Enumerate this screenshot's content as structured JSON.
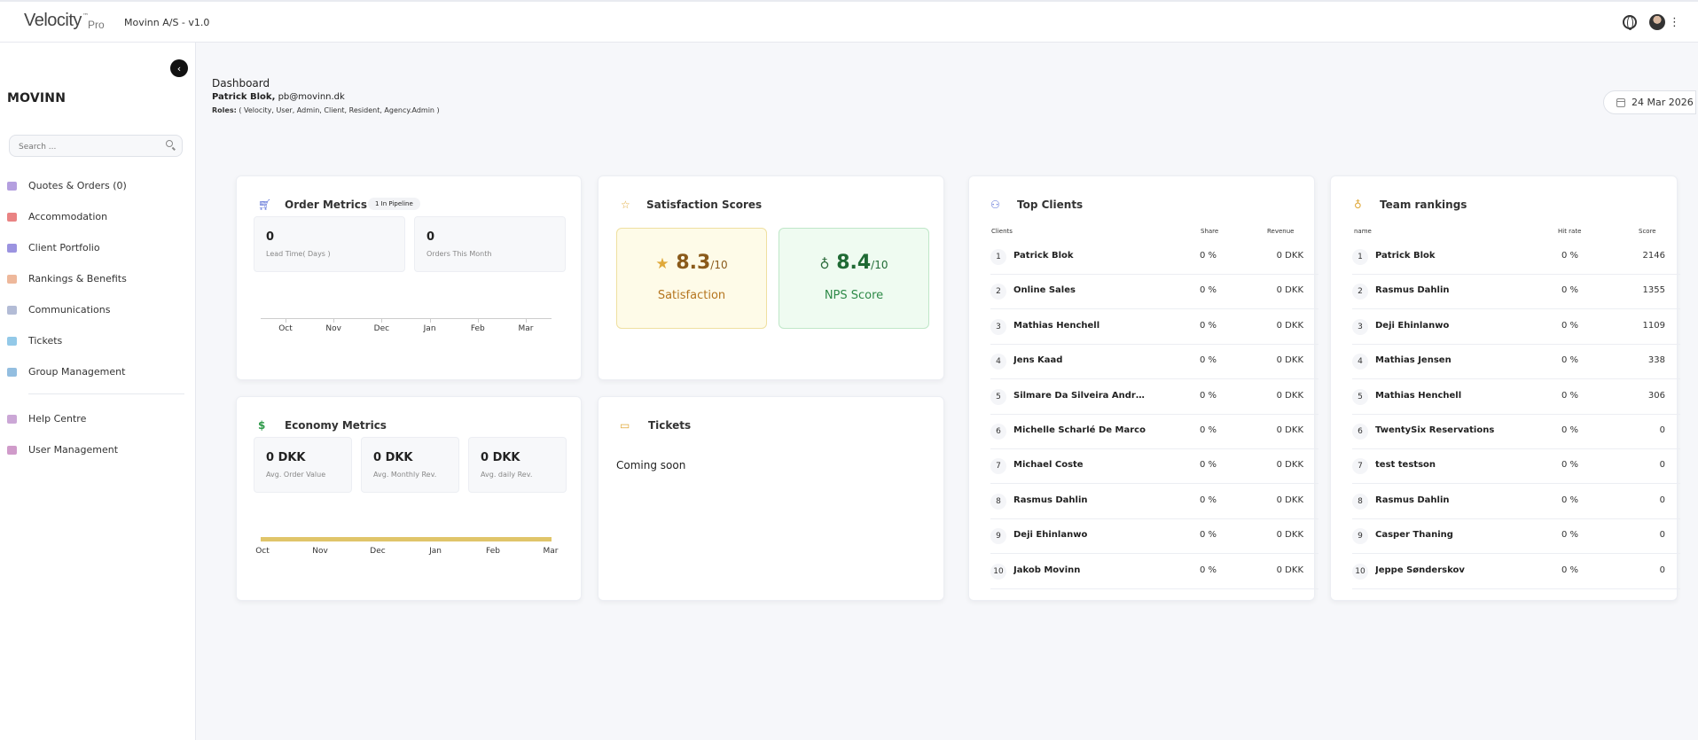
{
  "header": {
    "brand": "Velocity",
    "brand_tm": "™",
    "brand_sub": "Pro",
    "company": "Movinn A/S - v1.0"
  },
  "sidebar": {
    "org": "MOVINN",
    "search_placeholder": "Search ...",
    "items": [
      {
        "label": "Quotes & Orders (0)",
        "icon": "quotes-icon",
        "color": "#9b7fd4"
      },
      {
        "label": "Accommodation",
        "icon": "accommodation-icon",
        "color": "#e25a5a"
      },
      {
        "label": "Client Portfolio",
        "icon": "portfolio-icon",
        "color": "#7a6fd6"
      },
      {
        "label": "Rankings & Benefits",
        "icon": "rankings-icon",
        "color": "#e8a07a"
      },
      {
        "label": "Communications",
        "icon": "communications-icon",
        "color": "#9aa6c8"
      },
      {
        "label": "Tickets",
        "icon": "tickets-icon",
        "color": "#6fb7e0"
      },
      {
        "label": "Group Management",
        "icon": "group-icon",
        "color": "#6fa8d6"
      }
    ],
    "footer_items": [
      {
        "label": "Help Centre",
        "icon": "help-icon",
        "color": "#b98ac8"
      },
      {
        "label": "User Management",
        "icon": "user-management-icon",
        "color": "#c07ab8"
      }
    ]
  },
  "page": {
    "title": "Dashboard",
    "user_name": "Patrick Blok,",
    "user_email": "pb@movinn.dk",
    "roles_label": "Roles:",
    "roles": "( Velocity, User, Admin, Client, Resident, Agency.Admin )",
    "date": "24 Mar 2026"
  },
  "order_metrics": {
    "title": "Order Metrics",
    "pill": "1 In Pipeline",
    "lead_value": "0",
    "lead_label": "Lead Time( Days )",
    "orders_value": "0",
    "orders_label": "Orders This Month",
    "months": [
      "Oct",
      "Nov",
      "Dec",
      "Jan",
      "Feb",
      "Mar"
    ]
  },
  "economy_metrics": {
    "title": "Economy Metrics",
    "boxes": [
      {
        "value": "0 DKK",
        "label": "Avg. Order Value"
      },
      {
        "value": "0 DKK",
        "label": "Avg. Monthly Rev."
      },
      {
        "value": "0 DKK",
        "label": "Avg. daily Rev."
      }
    ],
    "months": [
      "Oct",
      "Nov",
      "Dec",
      "Jan",
      "Feb",
      "Mar"
    ],
    "line_color": "#e0c56a"
  },
  "satisfaction": {
    "title": "Satisfaction Scores",
    "satisfaction_value": "8.3",
    "satisfaction_max": "/10",
    "satisfaction_label": "Satisfaction",
    "nps_value": "8.4",
    "nps_max": "/10",
    "nps_label": "NPS Score"
  },
  "tickets": {
    "title": "Tickets",
    "body": "Coming soon"
  },
  "top_clients": {
    "title": "Top Clients",
    "headers": {
      "name": "Clients",
      "share": "Share",
      "revenue": "Revenue"
    },
    "rows": [
      {
        "rank": "1",
        "name": "Patrick Blok",
        "share": "0 %",
        "revenue": "0 DKK"
      },
      {
        "rank": "2",
        "name": "Online Sales",
        "share": "0 %",
        "revenue": "0 DKK"
      },
      {
        "rank": "3",
        "name": "Mathias Henchell",
        "share": "0 %",
        "revenue": "0 DKK"
      },
      {
        "rank": "4",
        "name": "Jens Kaad",
        "share": "0 %",
        "revenue": "0 DKK"
      },
      {
        "rank": "5",
        "name": "Silmare Da Silveira Andre...",
        "share": "0 %",
        "revenue": "0 DKK"
      },
      {
        "rank": "6",
        "name": "Michelle Scharlé De Marco",
        "share": "0 %",
        "revenue": "0 DKK"
      },
      {
        "rank": "7",
        "name": "Michael Coste",
        "share": "0 %",
        "revenue": "0 DKK"
      },
      {
        "rank": "8",
        "name": "Rasmus Dahlin",
        "share": "0 %",
        "revenue": "0 DKK"
      },
      {
        "rank": "9",
        "name": "Deji Ehinlanwo",
        "share": "0 %",
        "revenue": "0 DKK"
      },
      {
        "rank": "10",
        "name": "Jakob Movinn",
        "share": "0 %",
        "revenue": "0 DKK"
      }
    ]
  },
  "team_rankings": {
    "title": "Team rankings",
    "headers": {
      "name": "name",
      "share": "Hit rate",
      "revenue": "Score"
    },
    "rows": [
      {
        "rank": "1",
        "name": "Patrick Blok",
        "share": "0 %",
        "revenue": "2146"
      },
      {
        "rank": "2",
        "name": "Rasmus Dahlin",
        "share": "0 %",
        "revenue": "1355"
      },
      {
        "rank": "3",
        "name": "Deji Ehinlanwo",
        "share": "0 %",
        "revenue": "1109"
      },
      {
        "rank": "4",
        "name": "Mathias Jensen",
        "share": "0 %",
        "revenue": "338"
      },
      {
        "rank": "5",
        "name": "Mathias Henchell",
        "share": "0 %",
        "revenue": "306"
      },
      {
        "rank": "6",
        "name": "TwentySix Reservations",
        "share": "0 %",
        "revenue": "0"
      },
      {
        "rank": "7",
        "name": "test testson",
        "share": "0 %",
        "revenue": "0"
      },
      {
        "rank": "8",
        "name": "Rasmus Dahlin",
        "share": "0 %",
        "revenue": "0"
      },
      {
        "rank": "9",
        "name": "Casper Thaning",
        "share": "0 %",
        "revenue": "0"
      },
      {
        "rank": "10",
        "name": "Jeppe Sønderskov",
        "share": "0 %",
        "revenue": "0"
      }
    ]
  }
}
